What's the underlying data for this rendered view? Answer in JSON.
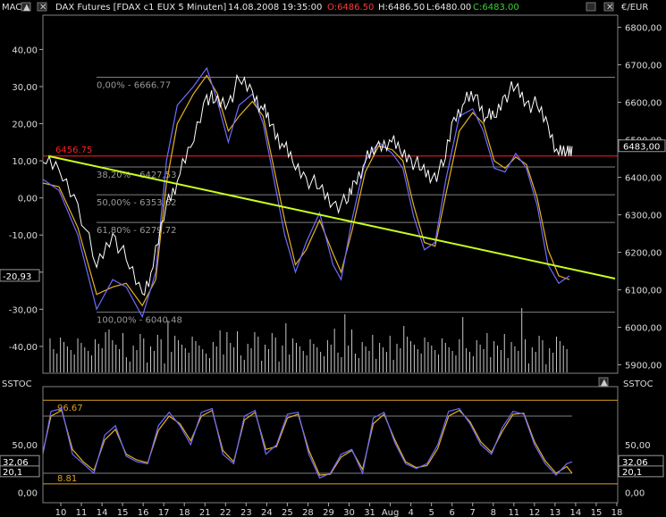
{
  "header": {
    "left_label": "MACD",
    "title_prefix": "DAX Futures [FDAX c1 EUX  5 Minuten]",
    "datetime": "14.08.2008 19:35:00",
    "open": "O:6486.50",
    "high": "H:6486.50",
    "low": "L:6480.00",
    "close": "C:6483.00",
    "currency_label": "€/EUR",
    "close_color": "#35d435",
    "open_color": "#ff3b3b"
  },
  "lower_header": {
    "left_label": "SSTOC",
    "right_label": "SSTOC"
  },
  "chart_data": [
    {
      "type": "line",
      "title": "DAX Futures [FDAX c1 EUX  5 Minuten]",
      "right_axis_ticks": [
        "6800,00",
        "6700,00",
        "6600,00",
        "6500,00",
        "6400,00",
        "6300,00",
        "6200,00",
        "6100,00",
        "6000,00",
        "5900,00"
      ],
      "left_axis_ticks": [
        "40,00",
        "30,00",
        "20,00",
        "10,00",
        "0,00",
        "-10,00",
        "-20,00",
        "-30,00",
        "-40,00"
      ],
      "ylim_price": [
        5880,
        6830
      ],
      "ylim_macd": [
        -47,
        49
      ],
      "last_price_badge": "6483,00",
      "macd_badge": "-20,93",
      "reference_line": {
        "label": "6456.75",
        "value": 6456.75,
        "color": "#ff2020"
      },
      "fibonacci_levels": [
        {
          "label": "0,00% - 6666.77",
          "value": 6666.77
        },
        {
          "label": "38,20% - 6427,53",
          "value": 6427.53
        },
        {
          "label": "50,00% - 6353,62",
          "value": 6353.62
        },
        {
          "label": "61,80% - 6279,72",
          "value": 6279.72
        },
        {
          "label": "100,00% - 6040.48",
          "value": 6040.48
        }
      ],
      "trendline": {
        "color": "#c8ff1e",
        "start": 6456.75,
        "end": 6130
      },
      "price_path": [
        [
          0,
          6440
        ],
        [
          0.6,
          6420
        ],
        [
          1.3,
          6330
        ],
        [
          2,
          6160
        ],
        [
          2.6,
          6250
        ],
        [
          3.1,
          6180
        ],
        [
          3.7,
          6090
        ],
        [
          4.1,
          6160
        ],
        [
          4.6,
          6330
        ],
        [
          5.0,
          6390
        ],
        [
          5.5,
          6480
        ],
        [
          6.1,
          6620
        ],
        [
          6.4,
          6600
        ],
        [
          6.9,
          6600
        ],
        [
          7.3,
          6660
        ],
        [
          7.8,
          6630
        ],
        [
          8.2,
          6580
        ],
        [
          8.5,
          6540
        ],
        [
          8.9,
          6490
        ],
        [
          9.3,
          6440
        ],
        [
          9.8,
          6400
        ],
        [
          10.3,
          6370
        ],
        [
          10.8,
          6330
        ],
        [
          11.3,
          6330
        ],
        [
          11.6,
          6390
        ],
        [
          12.0,
          6440
        ],
        [
          12.4,
          6480
        ],
        [
          12.9,
          6500
        ],
        [
          13.3,
          6470
        ],
        [
          13.7,
          6450
        ],
        [
          14.1,
          6420
        ],
        [
          14.5,
          6400
        ],
        [
          14.9,
          6430
        ],
        [
          15.3,
          6560
        ],
        [
          15.7,
          6600
        ],
        [
          16.1,
          6620
        ],
        [
          16.5,
          6560
        ],
        [
          16.8,
          6560
        ],
        [
          17.2,
          6620
        ],
        [
          17.6,
          6640
        ],
        [
          18.0,
          6600
        ],
        [
          18.4,
          6590
        ],
        [
          18.8,
          6540
        ],
        [
          19.2,
          6460
        ],
        [
          19.5,
          6470
        ],
        [
          19.7,
          6483
        ]
      ],
      "macd_fast": [
        [
          0,
          5
        ],
        [
          0.6,
          2
        ],
        [
          1.3,
          -10
        ],
        [
          2,
          -30
        ],
        [
          2.6,
          -22
        ],
        [
          3.1,
          -24
        ],
        [
          3.7,
          -32
        ],
        [
          4.2,
          -20
        ],
        [
          4.6,
          10
        ],
        [
          5.0,
          25
        ],
        [
          5.6,
          30
        ],
        [
          6.1,
          35
        ],
        [
          6.5,
          26
        ],
        [
          6.9,
          15
        ],
        [
          7.3,
          25
        ],
        [
          7.8,
          28
        ],
        [
          8.2,
          20
        ],
        [
          8.6,
          5
        ],
        [
          9.0,
          -10
        ],
        [
          9.4,
          -20
        ],
        [
          9.8,
          -12
        ],
        [
          10.3,
          -4
        ],
        [
          10.8,
          -18
        ],
        [
          11.1,
          -22
        ],
        [
          11.5,
          -6
        ],
        [
          12.0,
          10
        ],
        [
          12.5,
          15
        ],
        [
          13.0,
          12
        ],
        [
          13.4,
          8
        ],
        [
          13.8,
          -5
        ],
        [
          14.2,
          -14
        ],
        [
          14.6,
          -12
        ],
        [
          15.0,
          5
        ],
        [
          15.5,
          22
        ],
        [
          16.0,
          24
        ],
        [
          16.4,
          18
        ],
        [
          16.8,
          8
        ],
        [
          17.2,
          7
        ],
        [
          17.6,
          12
        ],
        [
          18.0,
          8
        ],
        [
          18.4,
          -2
        ],
        [
          18.8,
          -18
        ],
        [
          19.2,
          -23
        ],
        [
          19.6,
          -21
        ]
      ],
      "macd_slow": [
        [
          0,
          4
        ],
        [
          0.6,
          3
        ],
        [
          1.3,
          -8
        ],
        [
          2,
          -26
        ],
        [
          2.6,
          -24
        ],
        [
          3.1,
          -23
        ],
        [
          3.7,
          -29
        ],
        [
          4.2,
          -22
        ],
        [
          4.6,
          4
        ],
        [
          5.0,
          20
        ],
        [
          5.6,
          28
        ],
        [
          6.1,
          33
        ],
        [
          6.5,
          28
        ],
        [
          6.9,
          18
        ],
        [
          7.3,
          22
        ],
        [
          7.8,
          26
        ],
        [
          8.2,
          22
        ],
        [
          8.6,
          8
        ],
        [
          9.0,
          -6
        ],
        [
          9.4,
          -18
        ],
        [
          9.8,
          -14
        ],
        [
          10.3,
          -6
        ],
        [
          10.8,
          -15
        ],
        [
          11.1,
          -20
        ],
        [
          11.5,
          -9
        ],
        [
          12.0,
          7
        ],
        [
          12.5,
          14
        ],
        [
          13.0,
          13
        ],
        [
          13.4,
          10
        ],
        [
          13.8,
          -2
        ],
        [
          14.2,
          -12
        ],
        [
          14.6,
          -13
        ],
        [
          15.0,
          1
        ],
        [
          15.5,
          18
        ],
        [
          16.0,
          23
        ],
        [
          16.4,
          20
        ],
        [
          16.8,
          10
        ],
        [
          17.2,
          8
        ],
        [
          17.6,
          11
        ],
        [
          18.0,
          9
        ],
        [
          18.4,
          0
        ],
        [
          18.8,
          -14
        ],
        [
          19.2,
          -21
        ],
        [
          19.6,
          -22
        ]
      ]
    },
    {
      "type": "line",
      "title": "SSTOC",
      "axis_ticks": [
        "50,00",
        "0,00"
      ],
      "ylim": [
        -10,
        110
      ],
      "upper_level": {
        "label": "96.67",
        "value": 96.67
      },
      "lower_level": {
        "label": "8.81",
        "value": 8.81
      },
      "badges": [
        "32,06",
        "20,1"
      ],
      "x_tick_labels": [
        "10",
        "11",
        "14",
        "15",
        "16",
        "17",
        "18",
        "21",
        "22",
        "23",
        "24",
        "25",
        "28",
        "29",
        "30",
        "31",
        "Aug",
        "4",
        "5",
        "6",
        "7",
        "8",
        "11",
        "12",
        "13",
        "14",
        "15",
        "18"
      ],
      "stoch_k": [
        [
          0,
          40
        ],
        [
          0.3,
          85
        ],
        [
          0.7,
          88
        ],
        [
          1.1,
          40
        ],
        [
          1.5,
          30
        ],
        [
          1.9,
          20
        ],
        [
          2.3,
          60
        ],
        [
          2.7,
          70
        ],
        [
          3.1,
          38
        ],
        [
          3.5,
          32
        ],
        [
          3.9,
          30
        ],
        [
          4.3,
          70
        ],
        [
          4.7,
          84
        ],
        [
          5.1,
          70
        ],
        [
          5.5,
          50
        ],
        [
          5.9,
          84
        ],
        [
          6.3,
          88
        ],
        [
          6.7,
          40
        ],
        [
          7.1,
          30
        ],
        [
          7.5,
          80
        ],
        [
          7.9,
          86
        ],
        [
          8.3,
          40
        ],
        [
          8.7,
          50
        ],
        [
          9.1,
          82
        ],
        [
          9.5,
          84
        ],
        [
          9.9,
          40
        ],
        [
          10.3,
          15
        ],
        [
          10.7,
          20
        ],
        [
          11.1,
          40
        ],
        [
          11.5,
          45
        ],
        [
          11.9,
          20
        ],
        [
          12.3,
          78
        ],
        [
          12.7,
          84
        ],
        [
          13.1,
          52
        ],
        [
          13.5,
          30
        ],
        [
          13.9,
          25
        ],
        [
          14.3,
          30
        ],
        [
          14.7,
          50
        ],
        [
          15.1,
          85
        ],
        [
          15.5,
          88
        ],
        [
          15.9,
          72
        ],
        [
          16.3,
          50
        ],
        [
          16.7,
          40
        ],
        [
          17.1,
          68
        ],
        [
          17.5,
          85
        ],
        [
          17.9,
          82
        ],
        [
          18.3,
          50
        ],
        [
          18.7,
          30
        ],
        [
          19.1,
          18
        ],
        [
          19.5,
          30
        ],
        [
          19.7,
          32
        ]
      ],
      "stoch_d": [
        [
          0,
          42
        ],
        [
          0.3,
          80
        ],
        [
          0.7,
          86
        ],
        [
          1.1,
          45
        ],
        [
          1.5,
          32
        ],
        [
          1.9,
          23
        ],
        [
          2.3,
          55
        ],
        [
          2.7,
          66
        ],
        [
          3.1,
          40
        ],
        [
          3.5,
          34
        ],
        [
          3.9,
          31
        ],
        [
          4.3,
          65
        ],
        [
          4.7,
          80
        ],
        [
          5.1,
          72
        ],
        [
          5.5,
          54
        ],
        [
          5.9,
          80
        ],
        [
          6.3,
          86
        ],
        [
          6.7,
          44
        ],
        [
          7.1,
          32
        ],
        [
          7.5,
          76
        ],
        [
          7.9,
          84
        ],
        [
          8.3,
          45
        ],
        [
          8.7,
          48
        ],
        [
          9.1,
          78
        ],
        [
          9.5,
          82
        ],
        [
          9.9,
          44
        ],
        [
          10.3,
          18
        ],
        [
          10.7,
          19
        ],
        [
          11.1,
          37
        ],
        [
          11.5,
          44
        ],
        [
          11.9,
          24
        ],
        [
          12.3,
          72
        ],
        [
          12.7,
          82
        ],
        [
          13.1,
          55
        ],
        [
          13.5,
          32
        ],
        [
          13.9,
          26
        ],
        [
          14.3,
          28
        ],
        [
          14.7,
          46
        ],
        [
          15.1,
          80
        ],
        [
          15.5,
          86
        ],
        [
          15.9,
          74
        ],
        [
          16.3,
          53
        ],
        [
          16.7,
          42
        ],
        [
          17.1,
          64
        ],
        [
          17.5,
          82
        ],
        [
          17.9,
          83
        ],
        [
          18.3,
          53
        ],
        [
          18.7,
          33
        ],
        [
          19.1,
          20
        ],
        [
          19.5,
          27
        ],
        [
          19.7,
          20
        ]
      ]
    }
  ],
  "colors": {
    "macd_fast": "#6f6bff",
    "macd_slow": "#e6b21c",
    "price": "#ffffff",
    "grid": "#7f7f7f",
    "level": "#d9a020",
    "volume": "#c9c9c9"
  }
}
